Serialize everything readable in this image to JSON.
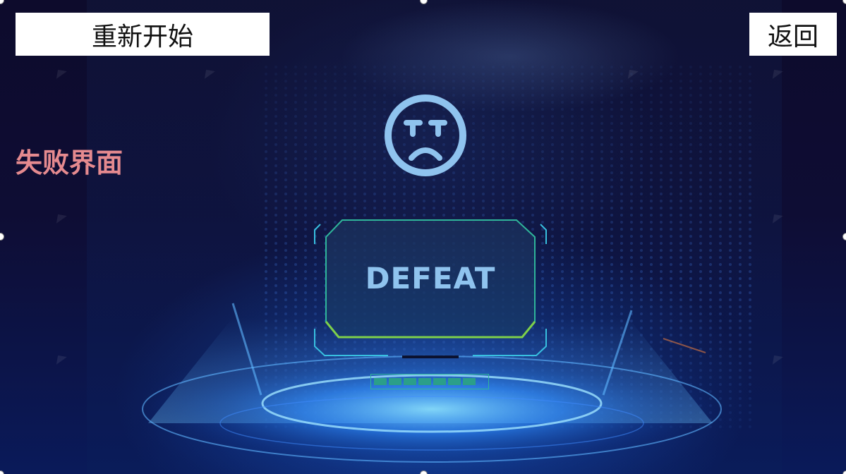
{
  "toolbar": {
    "restart_label": "重新开始",
    "back_label": "返回"
  },
  "screen_label": "失败界面",
  "result": {
    "text": "DEFEAT",
    "icon": "sad-face-icon"
  },
  "colors": {
    "label_pink": "#e58a8f",
    "icon_blue": "#8fc3ee",
    "frame_teal": "#2fb59a",
    "frame_green": "#7ed04a",
    "background": "#0c0a2a"
  }
}
